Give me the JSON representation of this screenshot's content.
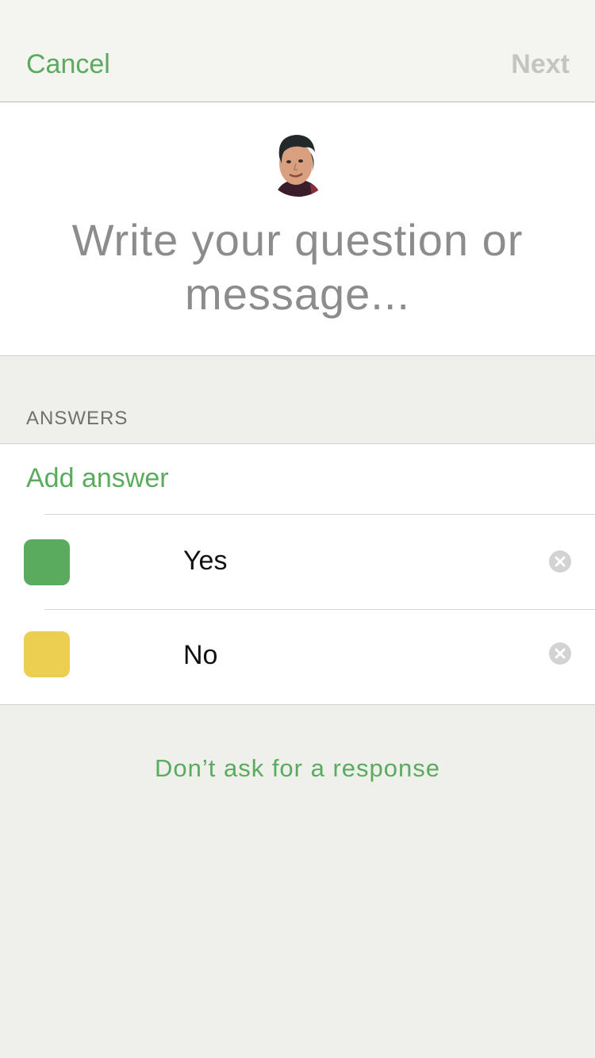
{
  "nav": {
    "cancel_label": "Cancel",
    "next_label": "Next"
  },
  "composer": {
    "placeholder": "Write your question or message..."
  },
  "answers": {
    "header": "ANSWERS",
    "add_label": "Add answer",
    "items": [
      {
        "label": "Yes",
        "color": "#5aab5e"
      },
      {
        "label": "No",
        "color": "#ecce51"
      }
    ]
  },
  "footer": {
    "no_response_label": "Don’t ask for a response"
  },
  "colors": {
    "accent": "#5aab5e",
    "disabled": "#c4c4c0"
  }
}
